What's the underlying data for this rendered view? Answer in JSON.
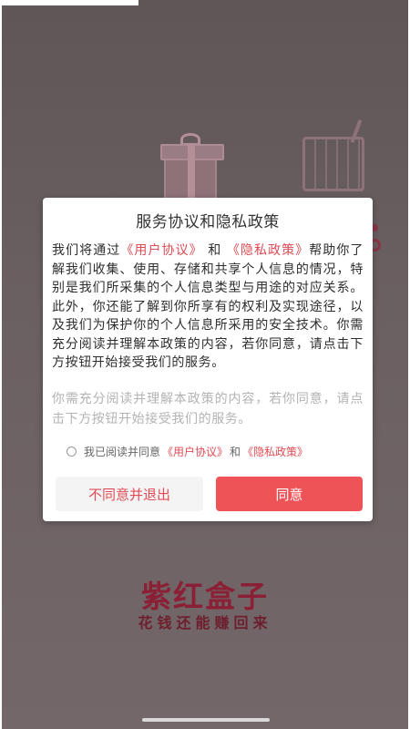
{
  "dialog": {
    "title": "服务协议和隐私政策",
    "body_p1": "我们将通过",
    "user_agreement_link": "《用户协议》",
    "body_and": "和",
    "privacy_policy_link": "《隐私政策》",
    "body_p2": "帮助你了解我们收集、使用、存储和共享个人信息的情况，特别是我们所采集的个人信息类型与用途的对应关系。此外，你还能了解到你所享有的权利及实现途径，以及我们为保护你的个人信息所采用的安全技术。你需充分阅读并理解本政策的内容，若你同意，请点击下方按钮开始接受我们的服务。",
    "note": "你需充分阅读并理解本政策的内容，若你同意，请点击下方按钮开始接受我们的服务。",
    "consent": {
      "prefix": "我已阅读并同意",
      "user_agreement": "《用户协议》",
      "and": "和",
      "privacy_policy": "《隐私政策》",
      "checked": false
    },
    "decline_label": "不同意并退出",
    "agree_label": "同意"
  },
  "brand": {
    "name": "紫红盒子",
    "slogan": "花钱还能赚回来"
  },
  "colors": {
    "accent": "#ee5358",
    "link": "#e04b55",
    "brand": "#8a1f35",
    "overlay": "#5f5657"
  }
}
